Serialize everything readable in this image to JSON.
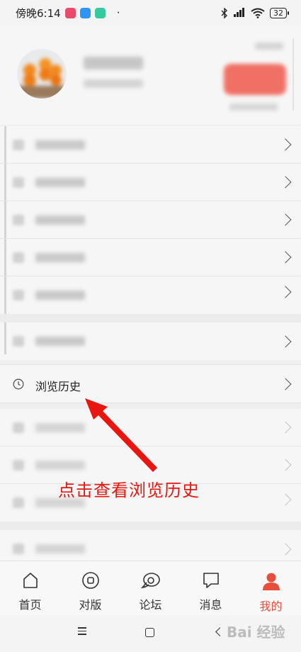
{
  "status_bar": {
    "time": "傍晚6:14",
    "battery": "32",
    "dot": "·"
  },
  "profile": {
    "username_blurred": true,
    "action_button_blurred": true
  },
  "menu_top": {
    "items_blurred_count": 6
  },
  "history": {
    "label": "浏览历史",
    "icon": "clock-icon"
  },
  "menu_bottom": {
    "items_blurred_count": 4
  },
  "annotation": {
    "text": "点击查看浏览历史",
    "color": "#e8160f"
  },
  "tabbar": {
    "tabs": [
      {
        "label": "首页",
        "icon": "home-icon"
      },
      {
        "label": "对版",
        "icon": "target-icon"
      },
      {
        "label": "论坛",
        "icon": "forum-icon"
      },
      {
        "label": "消息",
        "icon": "message-icon"
      },
      {
        "label": "我的",
        "icon": "profile-icon",
        "active": true
      }
    ],
    "active_color": "#e84e3d"
  },
  "watermark": {
    "text": "Bai 经验"
  }
}
